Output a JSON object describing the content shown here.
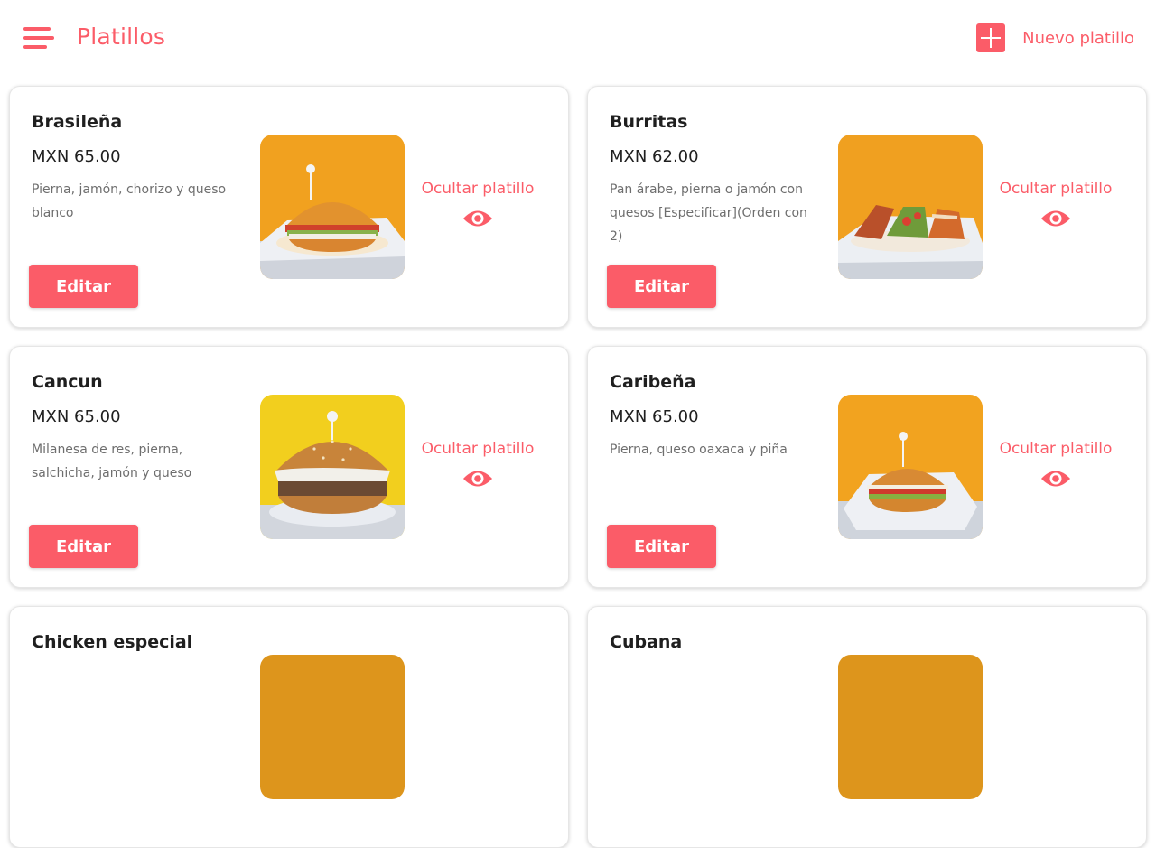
{
  "header": {
    "title": "Platillos",
    "new_button_label": "Nuevo platillo"
  },
  "colors": {
    "accent": "#fb5c68",
    "text_dark": "#1f1f1f",
    "text_muted": "#6e6e6e"
  },
  "dishes": [
    {
      "name": "Brasileña",
      "price": "MXN 65.00",
      "description": "Pierna, jamón, chorizo y queso blanco",
      "edit_label": "Editar",
      "hide_label": "Ocultar platillo",
      "photo_bg": "#f1a11f"
    },
    {
      "name": "Burritas",
      "price": "MXN 62.00",
      "description": "Pan árabe, pierna o jamón con quesos [Especificar](Orden con 2)",
      "edit_label": "Editar",
      "hide_label": "Ocultar platillo",
      "photo_bg": "#f0a020"
    },
    {
      "name": "Cancun",
      "price": "MXN 65.00",
      "description": "Milanesa de res, pierna, salchicha, jamón y queso",
      "edit_label": "Editar",
      "hide_label": "Ocultar platillo",
      "photo_bg": "#f2cf1e"
    },
    {
      "name": "Caribeña",
      "price": "MXN 65.00",
      "description": "Pierna, queso oaxaca y piña",
      "edit_label": "Editar",
      "hide_label": "Ocultar platillo",
      "photo_bg": "#f2a31f"
    },
    {
      "name": "Chicken especial",
      "price": "",
      "description": "",
      "edit_label": "",
      "hide_label": "",
      "photo_bg": "#dd951c"
    },
    {
      "name": "Cubana",
      "price": "",
      "description": "",
      "edit_label": "",
      "hide_label": "",
      "photo_bg": "#dd951c"
    }
  ]
}
